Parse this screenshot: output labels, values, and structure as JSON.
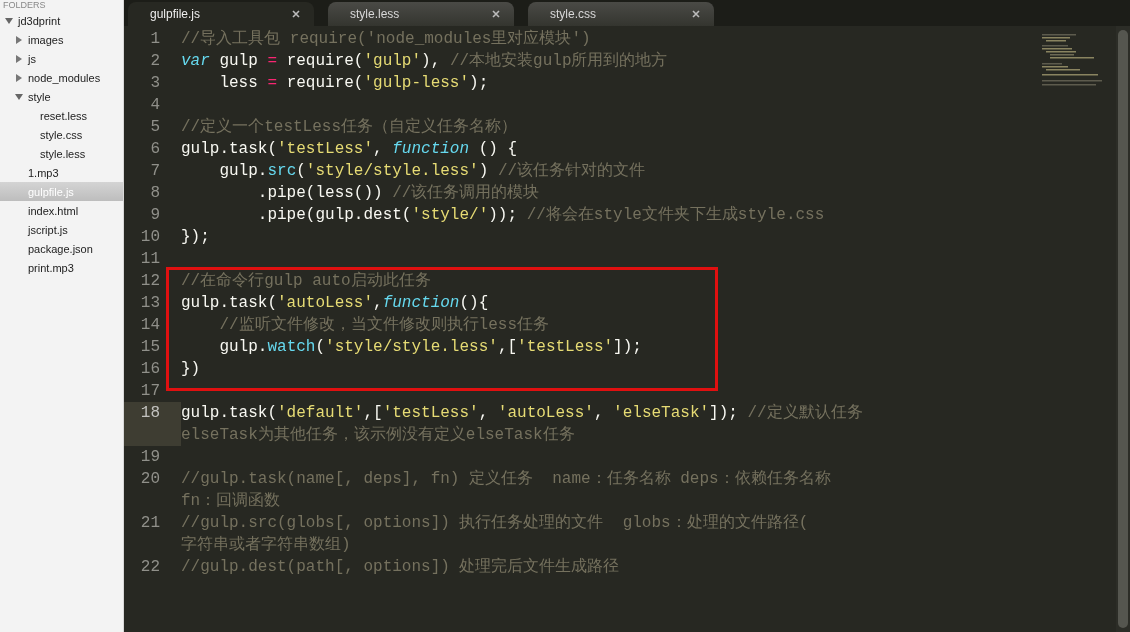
{
  "sidebar": {
    "header": "FOLDERS",
    "tree": [
      {
        "kind": "folder",
        "label": "jd3dprint",
        "expanded": true,
        "selected": false,
        "children": [
          {
            "kind": "folder",
            "label": "images",
            "expanded": false,
            "selected": false
          },
          {
            "kind": "folder",
            "label": "js",
            "expanded": false,
            "selected": false
          },
          {
            "kind": "folder",
            "label": "node_modules",
            "expanded": false,
            "selected": false
          },
          {
            "kind": "folder",
            "label": "style",
            "expanded": true,
            "selected": false,
            "children": [
              {
                "kind": "file",
                "label": "reset.less",
                "selected": false
              },
              {
                "kind": "file",
                "label": "style.css",
                "selected": false
              },
              {
                "kind": "file",
                "label": "style.less",
                "selected": false
              }
            ]
          },
          {
            "kind": "file",
            "label": "1.mp3",
            "selected": false
          },
          {
            "kind": "file",
            "label": "gulpfile.js",
            "selected": true
          },
          {
            "kind": "file",
            "label": "index.html",
            "selected": false
          },
          {
            "kind": "file",
            "label": "jscript.js",
            "selected": false
          },
          {
            "kind": "file",
            "label": "package.json",
            "selected": false
          },
          {
            "kind": "file",
            "label": "print.mp3",
            "selected": false
          }
        ]
      }
    ]
  },
  "tabs": [
    {
      "label": "gulpfile.js",
      "selected": true
    },
    {
      "label": "style.less",
      "selected": false
    },
    {
      "label": "style.css",
      "selected": false
    }
  ],
  "editor": {
    "lines": [
      {
        "number": "1",
        "boxed": false,
        "current": false,
        "rows": [
          [
            {
              "kind": "comment",
              "text": "//导入工具包 require('node_modules里对应模块')"
            }
          ]
        ]
      },
      {
        "number": "2",
        "boxed": false,
        "current": false,
        "rows": [
          [
            {
              "kind": "keyword",
              "text": "var"
            },
            {
              "kind": "plain",
              "text": " gulp "
            },
            {
              "kind": "operator",
              "text": "="
            },
            {
              "kind": "plain",
              "text": " require("
            },
            {
              "kind": "string",
              "text": "'gulp'"
            },
            {
              "kind": "plain",
              "text": "), "
            },
            {
              "kind": "comment",
              "text": "//本地安装gulp所用到的地方"
            }
          ]
        ]
      },
      {
        "number": "3",
        "boxed": false,
        "current": false,
        "rows": [
          [
            {
              "kind": "plain",
              "text": "    less "
            },
            {
              "kind": "operator",
              "text": "="
            },
            {
              "kind": "plain",
              "text": " require("
            },
            {
              "kind": "string",
              "text": "'gulp-less'"
            },
            {
              "kind": "plain",
              "text": ");"
            }
          ]
        ]
      },
      {
        "number": "4",
        "boxed": false,
        "current": false
      },
      {
        "number": "5",
        "boxed": false,
        "current": false,
        "rows": [
          [
            {
              "kind": "comment",
              "text": "//定义一个testLess任务（自定义任务名称）"
            }
          ]
        ]
      },
      {
        "number": "6",
        "boxed": false,
        "current": false,
        "rows": [
          [
            {
              "kind": "plain",
              "text": "gulp.task("
            },
            {
              "kind": "string",
              "text": "'testLess'"
            },
            {
              "kind": "plain",
              "text": ", "
            },
            {
              "kind": "keyword",
              "text": "function"
            },
            {
              "kind": "plain",
              "text": " () {"
            }
          ]
        ]
      },
      {
        "number": "7",
        "boxed": false,
        "current": false,
        "rows": [
          [
            {
              "kind": "plain",
              "text": "    gulp."
            },
            {
              "kind": "support",
              "text": "src"
            },
            {
              "kind": "plain",
              "text": "("
            },
            {
              "kind": "string",
              "text": "'style/style.less'"
            },
            {
              "kind": "plain",
              "text": ") "
            },
            {
              "kind": "comment",
              "text": "//该任务针对的文件"
            }
          ]
        ]
      },
      {
        "number": "8",
        "boxed": false,
        "current": false,
        "rows": [
          [
            {
              "kind": "plain",
              "text": "        .pipe(less()) "
            },
            {
              "kind": "comment",
              "text": "//该任务调用的模块"
            }
          ]
        ]
      },
      {
        "number": "9",
        "boxed": false,
        "current": false,
        "rows": [
          [
            {
              "kind": "plain",
              "text": "        .pipe(gulp.dest("
            },
            {
              "kind": "string",
              "text": "'style/'"
            },
            {
              "kind": "plain",
              "text": ")); "
            },
            {
              "kind": "comment",
              "text": "//将会在style文件夹下生成style.css"
            }
          ]
        ]
      },
      {
        "number": "10",
        "boxed": false,
        "current": false,
        "rows": [
          [
            {
              "kind": "plain",
              "text": "});"
            }
          ]
        ]
      },
      {
        "number": "11",
        "boxed": false,
        "current": false
      },
      {
        "number": "12",
        "boxed": true,
        "current": false,
        "rows": [
          [
            {
              "kind": "comment",
              "text": "//在命令行gulp auto启动此任务"
            }
          ]
        ]
      },
      {
        "number": "13",
        "boxed": true,
        "current": false,
        "rows": [
          [
            {
              "kind": "plain",
              "text": "gulp.task("
            },
            {
              "kind": "string",
              "text": "'autoLess'"
            },
            {
              "kind": "plain",
              "text": ","
            },
            {
              "kind": "keyword",
              "text": "function"
            },
            {
              "kind": "plain",
              "text": "(){"
            }
          ]
        ]
      },
      {
        "number": "14",
        "boxed": true,
        "current": false,
        "rows": [
          [
            {
              "kind": "plain",
              "text": "    "
            },
            {
              "kind": "comment",
              "text": "//监听文件修改，当文件修改则执行less任务"
            }
          ]
        ]
      },
      {
        "number": "15",
        "boxed": true,
        "current": false,
        "rows": [
          [
            {
              "kind": "plain",
              "text": "    gulp."
            },
            {
              "kind": "support",
              "text": "watch"
            },
            {
              "kind": "plain",
              "text": "("
            },
            {
              "kind": "string",
              "text": "'style/style.less'"
            },
            {
              "kind": "plain",
              "text": ",["
            },
            {
              "kind": "string",
              "text": "'testLess'"
            },
            {
              "kind": "plain",
              "text": "]);"
            }
          ]
        ]
      },
      {
        "number": "16",
        "boxed": true,
        "current": false,
        "rows": [
          [
            {
              "kind": "plain",
              "text": "})"
            }
          ]
        ]
      },
      {
        "number": "17",
        "boxed": true,
        "current": false
      },
      {
        "number": "18",
        "boxed": false,
        "current": true,
        "rows": [
          [
            {
              "kind": "plain",
              "text": "gulp.task("
            },
            {
              "kind": "string",
              "text": "'default'"
            },
            {
              "kind": "plain",
              "text": ",["
            },
            {
              "kind": "string",
              "text": "'testLess'"
            },
            {
              "kind": "plain",
              "text": ", "
            },
            {
              "kind": "string",
              "text": "'autoLess'"
            },
            {
              "kind": "plain",
              "text": ", "
            },
            {
              "kind": "string",
              "text": "'elseTask'"
            },
            {
              "kind": "plain",
              "text": "]); "
            },
            {
              "kind": "comment",
              "text": "//定义默认任务"
            }
          ],
          [
            {
              "kind": "comment",
              "text": "elseTask为其他任务，该示例没有定义elseTask任务"
            }
          ]
        ]
      },
      {
        "number": "19",
        "boxed": false,
        "current": false
      },
      {
        "number": "20",
        "boxed": false,
        "current": false,
        "rows": [
          [
            {
              "kind": "comment",
              "text": "//gulp.task(name[, deps], fn) 定义任务  name：任务名称 deps：依赖任务名称"
            }
          ],
          [
            {
              "kind": "comment",
              "text": "fn：回调函数"
            }
          ]
        ]
      },
      {
        "number": "21",
        "boxed": false,
        "current": false,
        "rows": [
          [
            {
              "kind": "comment",
              "text": "//gulp.src(globs[, options]) 执行任务处理的文件  globs：处理的文件路径("
            }
          ],
          [
            {
              "kind": "comment",
              "text": "字符串或者字符串数组)"
            }
          ]
        ]
      },
      {
        "number": "22",
        "boxed": false,
        "current": false,
        "rows": [
          [
            {
              "kind": "comment",
              "text": "//gulp.dest(path[, options]) 处理完后文件生成路径"
            }
          ]
        ]
      }
    ]
  }
}
